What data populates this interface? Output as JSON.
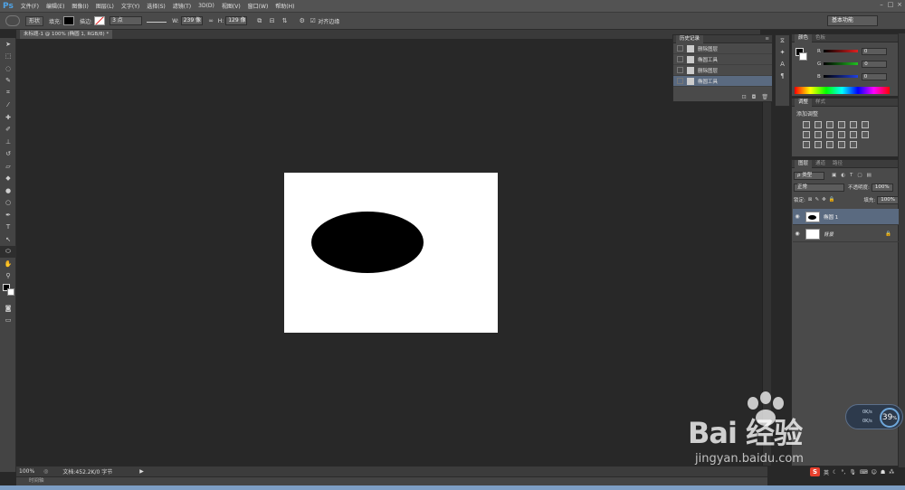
{
  "app": {
    "logo": "Ps"
  },
  "menu": [
    "文件(F)",
    "编辑(E)",
    "图像(I)",
    "图层(L)",
    "文字(Y)",
    "选择(S)",
    "滤镜(T)",
    "3D(D)",
    "视图(V)",
    "窗口(W)",
    "帮助(H)"
  ],
  "options": {
    "shape_mode": "形状",
    "fill_label": "填充:",
    "stroke_label": "描边:",
    "stroke_width": "3 点",
    "w_label": "W:",
    "w_value": "239 像",
    "h_label": "H:",
    "h_value": "129 像",
    "align_edges": "对齐边缘",
    "workspace": "基本功能",
    "fill_color": "#000000"
  },
  "document": {
    "tab_title": "未标题-1 @ 100% (椭圆 1, RGB/8) *",
    "zoom": "100%",
    "doc_info": "文档:452.2K/0 字节",
    "timeline_label": "时间轴",
    "shape_color": "#000000"
  },
  "history": {
    "tabs": [
      "历史记录"
    ],
    "items": [
      {
        "label": "删除图层",
        "selected": false
      },
      {
        "label": "椭圆工具",
        "selected": false
      },
      {
        "label": "删除图层",
        "selected": false
      },
      {
        "label": "椭圆工具",
        "selected": true
      }
    ]
  },
  "color_panel": {
    "tabs": [
      "颜色",
      "色板"
    ],
    "channels": [
      {
        "label": "R",
        "value": "0",
        "color": "#e02020"
      },
      {
        "label": "G",
        "value": "0",
        "color": "#20c020"
      },
      {
        "label": "B",
        "value": "0",
        "color": "#2040e0"
      }
    ]
  },
  "adjust_panel": {
    "tabs": [
      "调整",
      "样式"
    ],
    "add_label": "添加调整"
  },
  "layers_panel": {
    "tabs": [
      "图层",
      "通道",
      "路径"
    ],
    "filter": "ρ 类型",
    "blend_mode": "正常",
    "opacity_label": "不透明度:",
    "opacity_value": "100%",
    "lock_label": "锁定:",
    "fill_label": "填充:",
    "fill_value": "100%",
    "layers": [
      {
        "name": "椭圆 1",
        "selected": true
      },
      {
        "name": "背景",
        "selected": false
      }
    ]
  },
  "watermark": {
    "brand": "Bai 经验",
    "url": "jingyan.baidu.com"
  },
  "net_monitor": {
    "percent": "39",
    "unit": "%",
    "up": "0K/s",
    "down": "0K/s"
  },
  "tray": {
    "ime": "S",
    "ime_label": "英"
  }
}
